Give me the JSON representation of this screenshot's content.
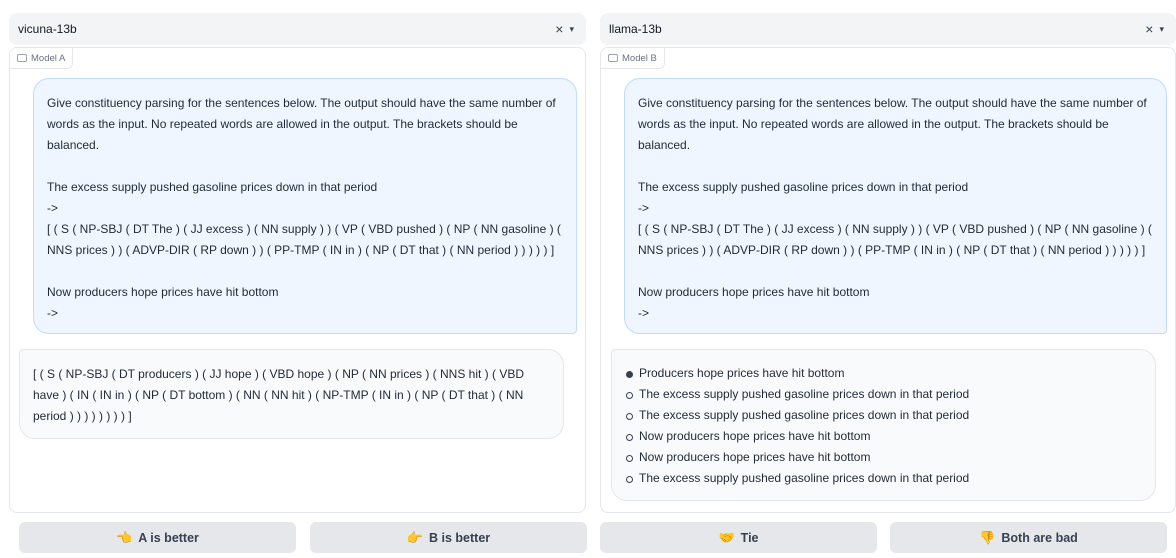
{
  "model_a": {
    "selector": "vicuna-13b",
    "label": "Model A",
    "user_message": {
      "p1": "Give constituency parsing for the sentences below. The output should have the same number of words as the input. No repeated words are allowed in the output. The brackets should be balanced.",
      "p2a": "The excess supply pushed gasoline prices down in that period",
      "p2b": "->",
      "p2c": "[ ( S ( NP-SBJ ( DT The ) ( JJ excess ) ( NN supply ) ) ( VP ( VBD pushed ) ( NP ( NN gasoline ) ( NNS prices ) ) ( ADVP-DIR ( RP down ) ) ( PP-TMP ( IN in ) ( NP ( DT that ) ( NN period ) ) ) ) ) ]",
      "p3a": "Now producers hope prices have hit bottom",
      "p3b": "->"
    },
    "bot_message": "[ ( S ( NP-SBJ ( DT producers ) ( JJ hope ) ( VBD hope ) ( NP ( NN prices ) ( NNS hit ) ( VBD have ) ( IN ( IN in ) ( NP ( DT bottom ) ( NN ( NN hit ) ( NP-TMP ( IN in ) ( NP ( DT that ) ( NN period ) ) ) ) ) ) ) ) ]"
  },
  "model_b": {
    "selector": "llama-13b",
    "label": "Model B",
    "user_message": {
      "p1": "Give constituency parsing for the sentences below. The output should have the same number of words as the input. No repeated words are allowed in the output. The brackets should be balanced.",
      "p2a": "The excess supply pushed gasoline prices down in that period",
      "p2b": "->",
      "p2c": "[ ( S ( NP-SBJ ( DT The ) ( JJ excess ) ( NN supply ) ) ( VP ( VBD pushed ) ( NP ( NN gasoline ) ( NNS prices ) ) ( ADVP-DIR ( RP down ) ) ( PP-TMP ( IN in ) ( NP ( DT that ) ( NN period ) ) ) ) ) ]",
      "p3a": "Now producers hope prices have hit bottom",
      "p3b": "->"
    },
    "bot_list": [
      "Producers hope prices have hit bottom",
      "The excess supply pushed gasoline prices down in that period",
      "The excess supply pushed gasoline prices down in that period",
      "Now producers hope prices have hit bottom",
      "Now producers hope prices have hit bottom",
      "The excess supply pushed gasoline prices down in that period"
    ]
  },
  "selector_controls": {
    "clear": "×",
    "dropdown": "▾"
  },
  "buttons": {
    "a_better": {
      "emoji": "👈",
      "label": "A is better"
    },
    "b_better": {
      "emoji": "👉",
      "label": "B is better"
    },
    "tie": {
      "emoji": "🤝",
      "label": "Tie"
    },
    "both_bad": {
      "emoji": "👎",
      "label": "Both are bad"
    }
  },
  "colors": {
    "user_bubble": "#eff6ff",
    "user_border": "#bfdbfe",
    "bot_bubble": "#f9fafb",
    "button_bg": "#e5e7eb"
  }
}
